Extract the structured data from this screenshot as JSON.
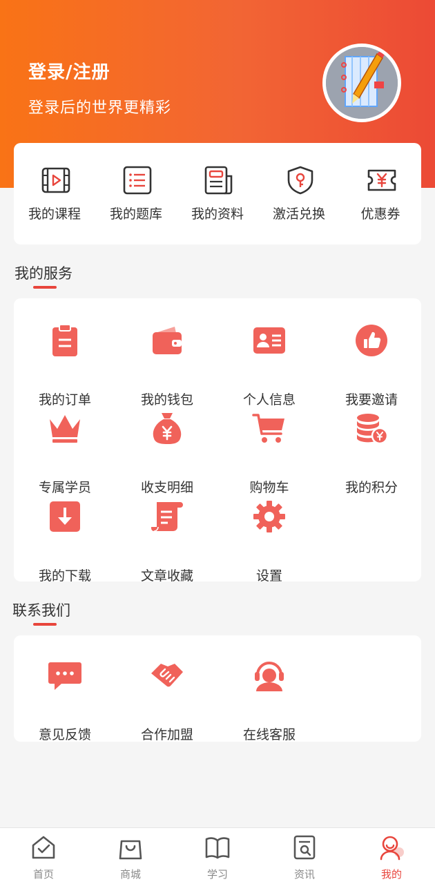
{
  "header": {
    "login_title": "登录/注册",
    "login_subtitle": "登录后的世界更精彩"
  },
  "quick_links": [
    {
      "label": "我的课程",
      "icon": "video-course-icon"
    },
    {
      "label": "我的题库",
      "icon": "question-list-icon"
    },
    {
      "label": "我的资料",
      "icon": "document-icon"
    },
    {
      "label": "激活兑换",
      "icon": "shield-key-icon"
    },
    {
      "label": "优惠券",
      "icon": "coupon-icon"
    }
  ],
  "services": {
    "title": "我的服务",
    "items": [
      {
        "label": "我的订单",
        "icon": "clipboard-icon"
      },
      {
        "label": "我的钱包",
        "icon": "wallet-icon"
      },
      {
        "label": "个人信息",
        "icon": "id-card-icon"
      },
      {
        "label": "我要邀请",
        "icon": "thumbs-up-icon"
      },
      {
        "label": "专属学员",
        "icon": "crown-icon"
      },
      {
        "label": "收支明细",
        "icon": "money-bag-icon"
      },
      {
        "label": "购物车",
        "icon": "cart-icon"
      },
      {
        "label": "我的积分",
        "icon": "coins-icon"
      },
      {
        "label": "我的下载",
        "icon": "download-icon"
      },
      {
        "label": "文章收藏",
        "icon": "scroll-icon"
      },
      {
        "label": "设置",
        "icon": "gear-icon"
      }
    ]
  },
  "contact": {
    "title": "联系我们",
    "items": [
      {
        "label": "意见反馈",
        "icon": "chat-bubble-icon"
      },
      {
        "label": "合作加盟",
        "icon": "handshake-icon"
      },
      {
        "label": "在线客服",
        "icon": "headset-icon"
      }
    ]
  },
  "tabbar": [
    {
      "label": "首页",
      "icon": "home-icon",
      "active": false
    },
    {
      "label": "商城",
      "icon": "shopping-bag-icon",
      "active": false
    },
    {
      "label": "学习",
      "icon": "book-icon",
      "active": false
    },
    {
      "label": "资讯",
      "icon": "news-icon",
      "active": false
    },
    {
      "label": "我的",
      "icon": "profile-icon",
      "active": true
    }
  ],
  "colors": {
    "accent": "#e8453c",
    "icon_fill": "#f0625a",
    "header_start": "#f97316",
    "header_end": "#ec4a35"
  }
}
